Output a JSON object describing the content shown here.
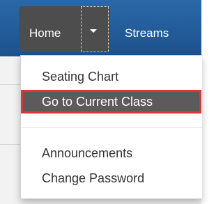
{
  "navbar": {
    "home_label": "Home",
    "streams_label": "Streams"
  },
  "menu": {
    "items": [
      {
        "label": "Seating Chart"
      },
      {
        "label": "Go to Current Class"
      },
      {
        "label": "Announcements"
      },
      {
        "label": "Change Password"
      }
    ],
    "highlighted_index": 1
  },
  "colors": {
    "navbar": "#1c528c",
    "active_tab": "#4d4d4d",
    "highlight": "#5b5b5b",
    "highlight_border": "#e0343a"
  }
}
